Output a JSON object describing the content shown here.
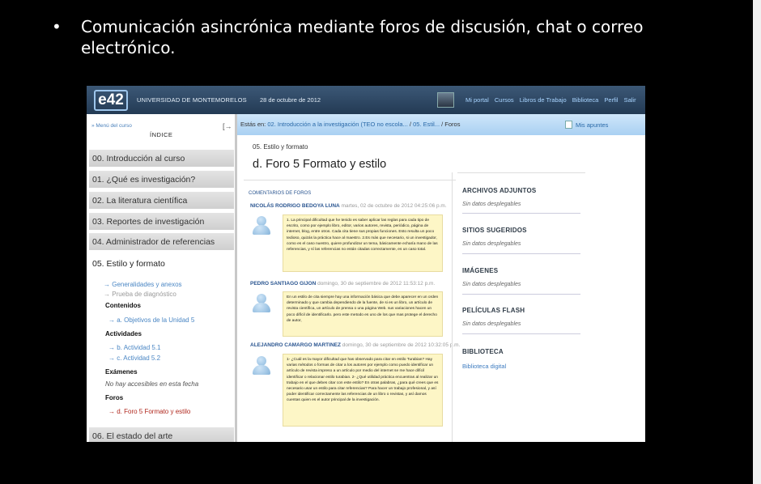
{
  "slide": {
    "bullet": "•",
    "text": "Comunicación asincrónica mediante foros de discusión, chat o correo electrónico."
  },
  "topbar": {
    "logo": "e42",
    "university": "UNIVERSIDAD DE MONTEMORELOS",
    "date": "28 de octubre de 2012",
    "nav": [
      "Mi portal",
      "Cursos",
      "Libros de Trabajo",
      "Biblioteca",
      "Perfil",
      "Salir"
    ]
  },
  "breadcrumb": {
    "prefix": "Estás en:",
    "link1": "02. Introducción a la investigación (TEO no escola...",
    "sep": "/",
    "link2": "05. Estil...",
    "current": "/ Foros",
    "apuntes": "Mis apuntes"
  },
  "sidebar": {
    "menu_label": "Menú del curso",
    "indice": "ÍNDICE",
    "expand_icon": "[→",
    "items": [
      "00. Introducción al curso",
      "01. ¿Qué es investigación?",
      "02. La literatura científica",
      "03. Reportes de investigación",
      "04. Administrador de referencias"
    ],
    "active": {
      "title": "05. Estilo y formato",
      "gen": "Generalidades y anexos",
      "prueba": "Prueba de diagnóstico",
      "contenidos": "Contenidos",
      "objetivos": "a. Objetivos de la Unidad 5",
      "actividades": "Actividades",
      "act1": "b. Actividad 5.1",
      "act2": "c. Actividad 5.2",
      "examenes": "Exámenes",
      "no_exam": "No hay accesibles en esta fecha",
      "foros": "Foros",
      "foro_actual": "d. Foro 5 Formato y estilo"
    },
    "last_item": "06. El estado del arte"
  },
  "main": {
    "crumb": "05. Estilo y formato",
    "title": "d. Foro 5 Formato y estilo",
    "section": "COMENTARIOS DE FOROS",
    "posts": [
      {
        "author": "NICOLÁS RODRIGO BEDOYA LUNA",
        "meta": "martes, 02 de octubre de 2012 04:25:06 p.m.",
        "text": "1. La principal dificultad que he tenido es saber aplicar las reglas para cada tipo de escrito, como por ejemplo libro, editor, varios autores, revista, periódico, página de internet, blog, entre otros. Cada cita tiene sus propias funciones. Esto resulta un poco tedioso, quizás la práctica hace al maestro. 2.Es más que necesario, si un investigador, como es el caso nuestro, quiere profundizar un tema, básicamente echaría mano de las referencias, y sí las referencias no están citadas correctamente, es un caso total."
      },
      {
        "author": "PEDRO SANTIAGO GIJON",
        "meta": "domingo, 30 de septiembre de 2012 11:53:12 p.m.",
        "text": "En un estilo de cita siempre hay una información básica que debe aparecer en un orden determinado y que cambia dependiendo de la fuente, de si es un libro, un artículo de revista científica, un artículo de prensa o una página Web. sus variaciones hacen un poco difícil de identificarlo. pero este metodo es uno de los que mas protege el derecho de autor,"
      },
      {
        "author": "ALEJANDRO CAMARGO MARTINEZ",
        "meta": "domingo, 30 de septiembre de 2012 10:32:05 p.m.",
        "text": "1- ¿Cuál es la mayor dificultad que has observado para citar en estilo Turabian? Hay varias métodos o formas de citar a los autores por ejemplo como puedo identificar un artículo de revista impreso a un artículo por medio del internet se me hace difícil identificar o relacionar estilo turabian. 2- ¿Qué utilidad práctica encuentras al realizar un trabajo en el que debes citar con este estilo? En otras palabras, ¿para qué crees que es necesario usar un estilo para citar referencias? Para hacer un trabajo profesional, y así poder identificar correctamente las referencias de un libro o revistas, y así damos cuentas quien es el autor principal de la investigación."
      }
    ]
  },
  "right_panel": {
    "archivos": "ARCHIVOS ADJUNTOS",
    "sitios": "SITIOS SUGERIDOS",
    "imagenes": "IMÁGENES",
    "peliculas": "PELÍCULAS FLASH",
    "biblioteca": "BIBLIOTECA",
    "empty": "Sin datos desplegables",
    "biblioteca_link": "Biblioteca digital"
  }
}
